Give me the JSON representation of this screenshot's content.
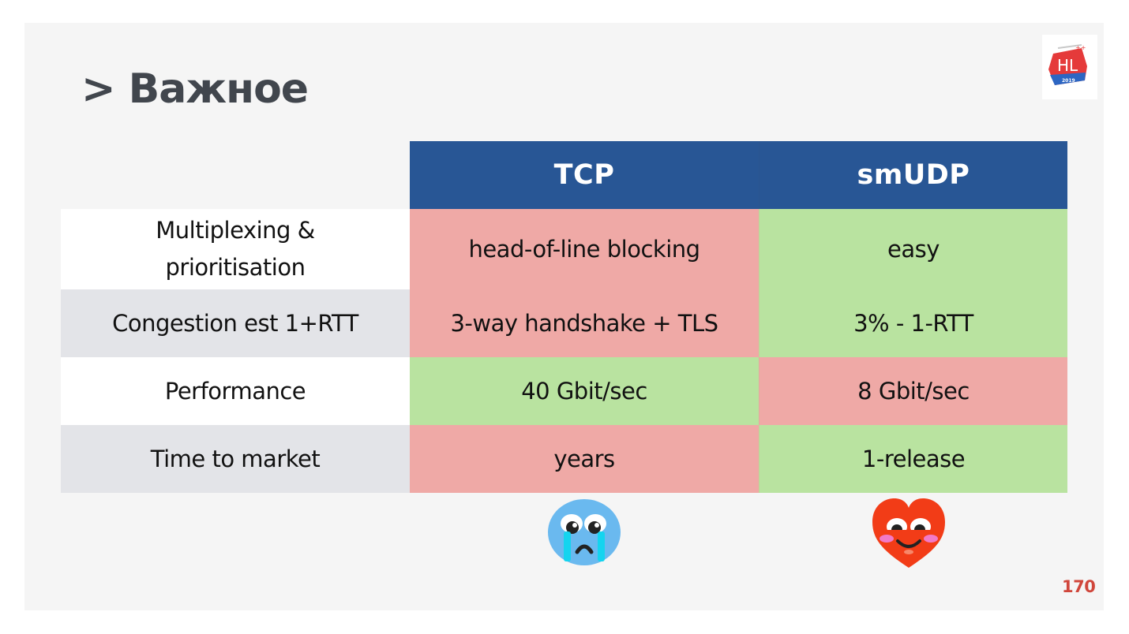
{
  "slide": {
    "title": "> Важное",
    "page_number": "170",
    "logo": {
      "text": "HL",
      "year": "2019",
      "icon": "highload-logo-icon"
    }
  },
  "table": {
    "columns": [
      "",
      "TCP",
      "smUDP"
    ],
    "rows": [
      {
        "label": "Multiplexing & prioritisation",
        "tcp": {
          "value": "head-of-line blocking",
          "rating": "bad"
        },
        "smudp": {
          "value": "easy",
          "rating": "good"
        }
      },
      {
        "label": "Congestion est 1+RTT",
        "tcp": {
          "value": "3-way handshake + TLS",
          "rating": "bad"
        },
        "smudp": {
          "value": "3% - 1-RTT",
          "rating": "good"
        }
      },
      {
        "label": "Performance",
        "tcp": {
          "value": "40 Gbit/sec",
          "rating": "good"
        },
        "smudp": {
          "value": "8 Gbit/sec",
          "rating": "bad"
        }
      },
      {
        "label": "Time to market",
        "tcp": {
          "value": "years",
          "rating": "bad"
        },
        "smudp": {
          "value": "1-release",
          "rating": "good"
        }
      }
    ]
  },
  "emojis": {
    "tcp": "crying-face-icon",
    "smudp": "smiling-heart-icon"
  },
  "colors": {
    "header": "#285695",
    "bad": "#efa9a6",
    "good": "#b9e3a0",
    "title": "#41464d",
    "page_number": "#d0463b"
  }
}
